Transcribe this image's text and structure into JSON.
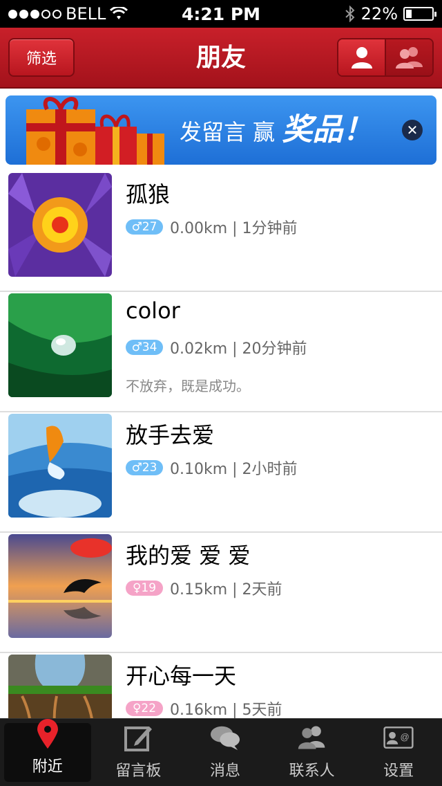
{
  "status_bar": {
    "carrier": "BELL",
    "time": "4:21 PM",
    "battery_percent": "22%",
    "battery_level": 0.22
  },
  "nav": {
    "title": "朋友",
    "filter_label": "筛选"
  },
  "banner": {
    "text_part1": "发留言 赢 ",
    "text_part2": "奖品！"
  },
  "friends": [
    {
      "name": "孤狼",
      "gender_badge": "♂27",
      "gender": "male",
      "distance_time": "0.00km | 1分钟前",
      "signature": ""
    },
    {
      "name": "color",
      "gender_badge": "♂34",
      "gender": "male",
      "distance_time": "0.02km | 20分钟前",
      "signature": "不放弃，既是成功。"
    },
    {
      "name": "放手去爱",
      "gender_badge": "♂23",
      "gender": "male",
      "distance_time": "0.10km | 2小时前",
      "signature": ""
    },
    {
      "name": "我的爱 爱 爱",
      "gender_badge": "♀19",
      "gender": "female",
      "distance_time": "0.15km | 2天前",
      "signature": ""
    },
    {
      "name": "开心每一天",
      "gender_badge": "♀22",
      "gender": "female",
      "distance_time": "0.16km | 5天前",
      "signature": ""
    }
  ],
  "tabs": [
    {
      "label": "附近",
      "icon": "location-pin-icon",
      "active": true
    },
    {
      "label": "留言板",
      "icon": "edit-icon",
      "active": false
    },
    {
      "label": "消息",
      "icon": "chat-bubbles-icon",
      "active": false
    },
    {
      "label": "联系人",
      "icon": "contacts-icon",
      "active": false
    },
    {
      "label": "设置",
      "icon": "settings-card-icon",
      "active": false
    }
  ]
}
